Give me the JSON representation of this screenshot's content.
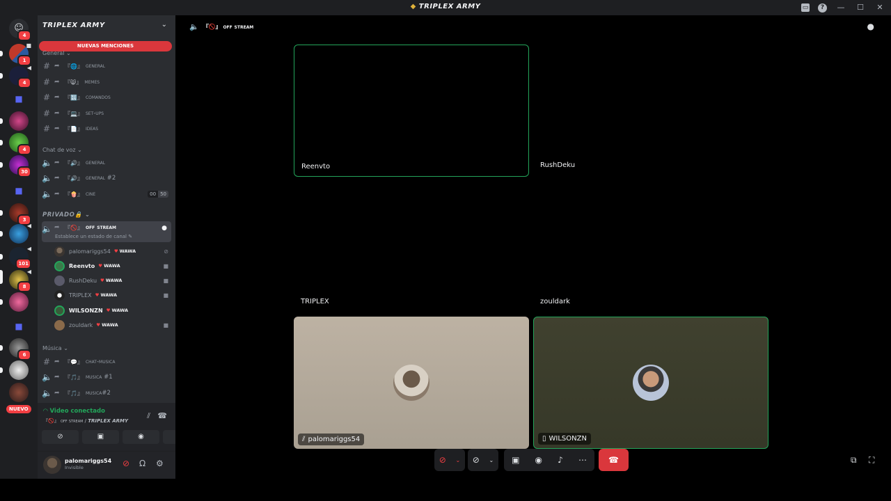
{
  "window": {
    "title": "TRIPLEX ARMY",
    "controls": [
      "inbox-icon",
      "help-icon",
      "minimize-icon",
      "maximize-icon",
      "close-icon"
    ]
  },
  "rail": {
    "home_badge": "4",
    "servers": [
      {
        "badge": "1"
      },
      {
        "badge": "4"
      },
      {
        "badge": ""
      },
      {
        "badge": "4"
      },
      {
        "badge": "30"
      },
      {
        "badge": "3"
      },
      {
        "badge": "101"
      },
      {
        "badge": "8"
      },
      {
        "badge": ""
      },
      {
        "badge": "6"
      }
    ],
    "new_label": "NUEVO"
  },
  "sidebar": {
    "guild_name": "TRIPLEX ARMY",
    "mentions_label": "NUEVAS MENCIONES",
    "cat_general": "General",
    "cat_voice": "Chat de voz",
    "cat_private": "PRIVADO🔒",
    "cat_music": "Música",
    "text_channels": [
      {
        "emoji": "『🌐』",
        "name": "general"
      },
      {
        "emoji": "『😸』",
        "name": "memes"
      },
      {
        "emoji": "『🔣』",
        "name": "comandos"
      },
      {
        "emoji": "『💻』",
        "name": "set-ups"
      },
      {
        "emoji": "『📄』",
        "name": "ideas"
      }
    ],
    "voice_channels": [
      {
        "emoji": "『🔊』",
        "name": "general",
        "count": ""
      },
      {
        "emoji": "『🔊』",
        "name": "general #2",
        "count": ""
      },
      {
        "emoji": "『🍿』",
        "name": "cine",
        "count_a": "00",
        "count_b": "50"
      }
    ],
    "active_channel": {
      "emoji": "『🚫』",
      "name": "off stream",
      "status": "Establece un estado de canal"
    },
    "members": [
      {
        "name": "palomariggs54",
        "tag": "WAWA"
      },
      {
        "name": "Reenvto",
        "tag": "WAWA"
      },
      {
        "name": "RushDeku",
        "tag": "WAWA"
      },
      {
        "name": "TRIPLEX",
        "tag": "WAWA"
      },
      {
        "name": "WILSONZN",
        "tag": "WAWA"
      },
      {
        "name": "zouldark",
        "tag": "WAWA"
      }
    ],
    "music_channels": [
      {
        "emoji": "『💬』",
        "name": "chat-musica"
      },
      {
        "emoji": "『🎵』",
        "name": "musica #1"
      },
      {
        "emoji": "『🎵』",
        "name": "musica#2"
      }
    ]
  },
  "voice_panel": {
    "title": "Video conectado",
    "subtitle_channel": "『🚫』 off stream / ",
    "subtitle_guild": "TRIPLEX ARMY"
  },
  "user_panel": {
    "name": "palomariggs54",
    "status": "Invisible"
  },
  "main": {
    "channel_name": "『🚫』 off stream",
    "tiles": [
      {
        "name": "Reenvto"
      },
      {
        "name": "RushDeku"
      },
      {
        "name": "TRIPLEX"
      },
      {
        "name": "zouldark"
      },
      {
        "name": "palomariggs54"
      },
      {
        "name": "WILSONZN"
      }
    ]
  },
  "colors": {
    "speaking": "#23a55a",
    "danger": "#da373c",
    "sidebar": "#2b2d31",
    "rail": "#1e1f22"
  }
}
